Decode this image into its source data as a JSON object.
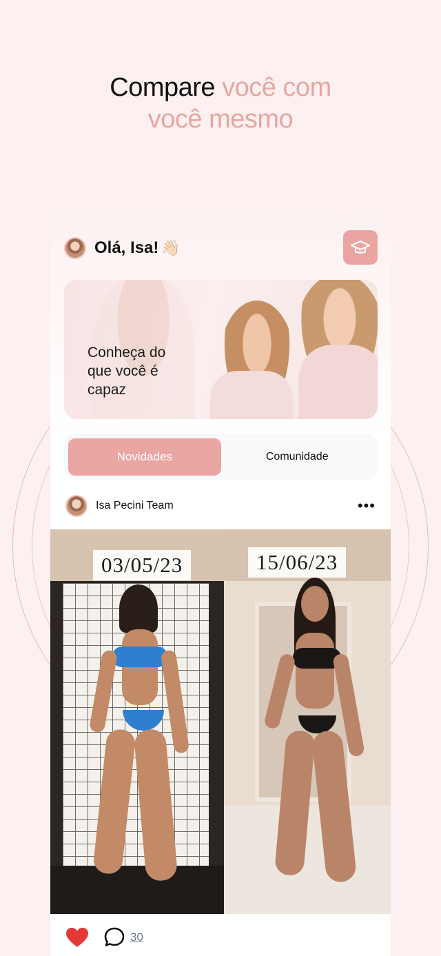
{
  "headline": {
    "part1": "Compare ",
    "part2": "você com",
    "part3": "você mesmo"
  },
  "colors": {
    "accent": "#e6a7a3",
    "button": "#eaa5a2",
    "background": "#fdf0f0",
    "like": "#e53935"
  },
  "header": {
    "greeting": "Olá, Isa!",
    "wave_emoji": "👋🏻",
    "cap_icon": "graduation-cap-icon"
  },
  "banner": {
    "text": "Conheça do que você é capaz"
  },
  "tabs": [
    {
      "label": "Novidades",
      "active": true
    },
    {
      "label": "Comunidade",
      "active": false
    }
  ],
  "post": {
    "author": "Isa Pecini Team",
    "more_icon": "more-horizontal-icon",
    "date_before": "03/05/23",
    "date_after": "15/06/23",
    "liked": true,
    "comments": "30"
  }
}
